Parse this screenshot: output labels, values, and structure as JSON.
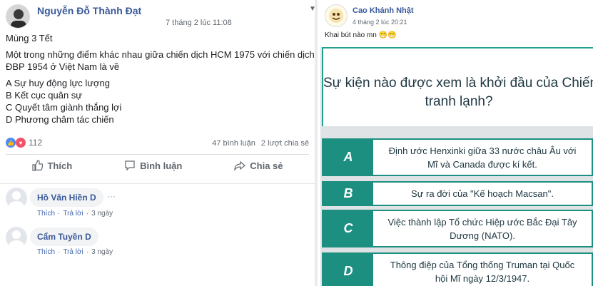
{
  "left_post": {
    "author": "Nguyễn Đỗ Thành Đạt",
    "timestamp": "7 tháng 2 lúc 11:08",
    "lines": [
      "Mùng 3 Tết",
      "Một trong những điểm khác nhau giữa chiến dịch HCM 1975 với chiến dịch",
      "ĐBP 1954 ở Việt Nam là về",
      "A Sự huy động lực lượng",
      "B Kết cục quân sự",
      "C Quyết tâm giành thắng lợi",
      "D Phương châm tác chiến"
    ],
    "reaction_count": "112",
    "comments_count": "47 bình luận",
    "shares_count": "2 lượt chia sẻ",
    "actions": {
      "like": "Thích",
      "comment": "Bình luận",
      "share": "Chia sẻ"
    },
    "comments": [
      {
        "name": "Hồ Văn Hiền D",
        "like": "Thích",
        "reply": "Trả lời",
        "time": "3 ngày"
      },
      {
        "name": "Cẩm Tuyền D",
        "like": "Thích",
        "reply": "Trả lời",
        "time": "3 ngày"
      }
    ]
  },
  "right_post": {
    "author": "Cao Khánh Nhật",
    "timestamp": "4 tháng 2 lúc 20:21",
    "text": "Khai bút nào mn 😁😁",
    "quiz": {
      "question_line1": "Sự kiện nào được xem là khởi đầu của Chiến",
      "question_line2": "tranh lạnh?",
      "options": [
        {
          "letter": "A",
          "line1": "Định ước Henxinki giữa 33 nước châu Âu với",
          "line2": "Mĩ và Canada được kí kết."
        },
        {
          "letter": "B",
          "line1": "Sự ra đời của \"Kế hoạch Macsan\".",
          "line2": ""
        },
        {
          "letter": "C",
          "line1": "Việc thành lập Tổ chức Hiệp ước Bắc Đại Tây",
          "line2": "Dương (NATO)."
        },
        {
          "letter": "D",
          "line1": "Thông điệp của Tổng thống Truman tại Quốc",
          "line2": "hội Mĩ ngày 12/3/1947."
        }
      ]
    }
  },
  "colors": {
    "link_blue": "#385898",
    "quiz_teal": "#1c8f80",
    "like_blue": "#4d8bf5",
    "love_red": "#f25268"
  },
  "icons": {
    "like": "thumbs-up-icon",
    "comment": "speech-bubble-icon",
    "share": "share-arrow-icon",
    "privacy": "globe-icon",
    "more": "ellipsis-icon",
    "dropdown": "chevron-down-icon"
  }
}
